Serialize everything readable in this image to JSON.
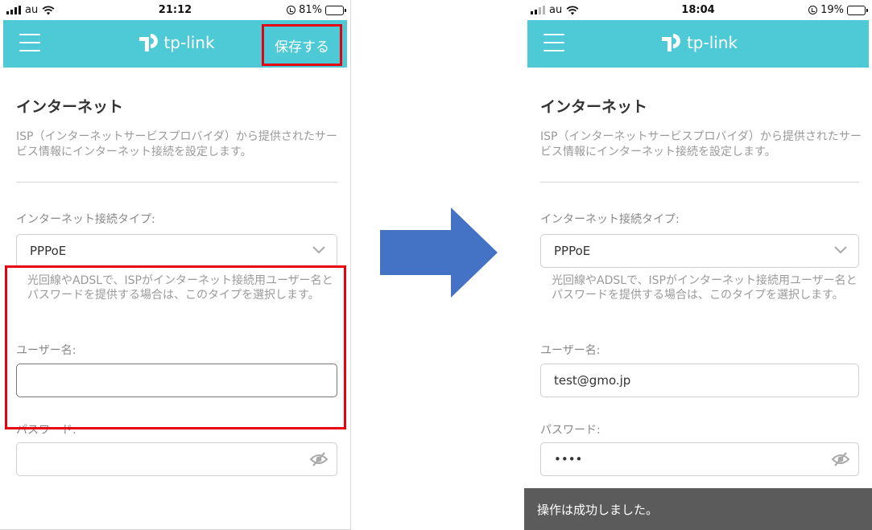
{
  "colors": {
    "accent": "#4ec9d6",
    "highlight": "#e50012",
    "toast_bg": "#5b5b5b",
    "arrow": "#4472c4"
  },
  "left": {
    "status": {
      "carrier": "au",
      "time": "21:12",
      "battery": "81%",
      "battery_level": 0.81
    },
    "appbar": {
      "menu_icon": "hamburger-menu-icon",
      "logo_text": "tp-link",
      "save_label": "保存する"
    },
    "page": {
      "title": "インターネット",
      "description": "ISP（インターネットサービスプロバイダ）から提供されたサービス情報にインターネット接続を設定します。",
      "connection_type_label": "インターネット接続タイプ:",
      "connection_type_value": "PPPoE",
      "connection_hint": "光回線やADSLで、ISPがインターネット接続用ユーザー名とパスワードを提供する場合は、このタイプを選択します。",
      "username_label": "ユーザー名:",
      "username_value": "",
      "password_label": "パスワード:",
      "password_value": ""
    }
  },
  "right": {
    "status": {
      "carrier": "au",
      "time": "18:04",
      "battery": "19%",
      "battery_level": 0.19
    },
    "appbar": {
      "menu_icon": "hamburger-menu-icon",
      "logo_text": "tp-link"
    },
    "page": {
      "title": "インターネット",
      "description": "ISP（インターネットサービスプロバイダ）から提供されたサービス情報にインターネット接続を設定します。",
      "connection_type_label": "インターネット接続タイプ:",
      "connection_type_value": "PPPoE",
      "connection_hint": "光回線やADSLで、ISPがインターネット接続用ユーザー名とパスワードを提供する場合は、このタイプを選択します。",
      "username_label": "ユーザー名:",
      "username_value": "test@gmo.jp",
      "password_label": "パスワード:",
      "password_value": "••••"
    },
    "toast": "操作は成功しました。"
  }
}
